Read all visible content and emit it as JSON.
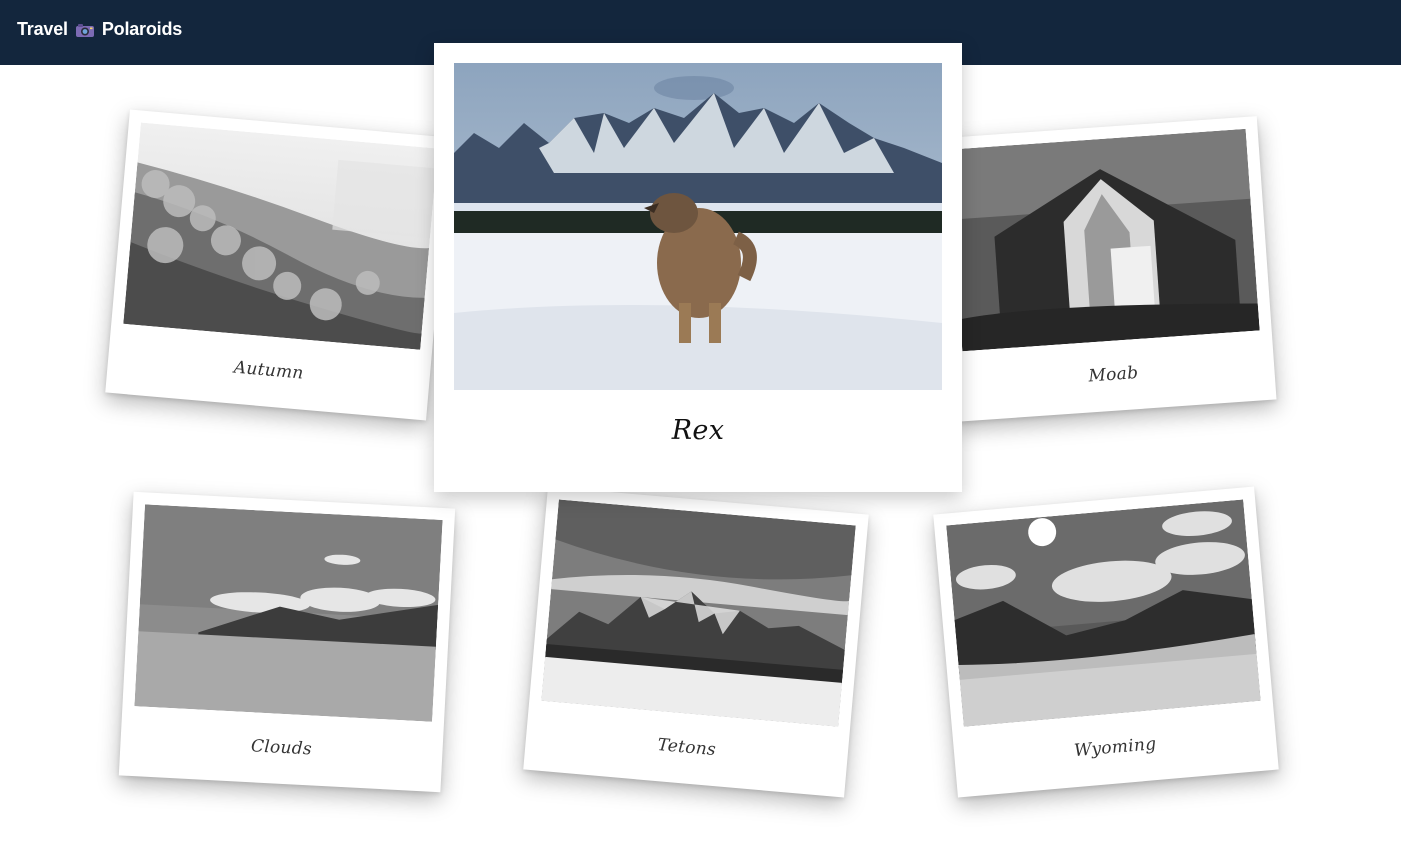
{
  "app": {
    "title_left": "Travel",
    "title_icon": "camera-icon",
    "title_right": "Polaroids",
    "colors": {
      "header_bg": "#13263d",
      "header_text": "#ffffff",
      "page_bg": "#ffffff"
    }
  },
  "photos": [
    {
      "id": "autumn",
      "caption": "Autumn"
    },
    {
      "id": "rex",
      "caption": "Rex",
      "featured": true
    },
    {
      "id": "moab",
      "caption": "Moab"
    },
    {
      "id": "clouds",
      "caption": "Clouds"
    },
    {
      "id": "tetons",
      "caption": "Tetons"
    },
    {
      "id": "wyoming",
      "caption": "Wyoming"
    }
  ]
}
